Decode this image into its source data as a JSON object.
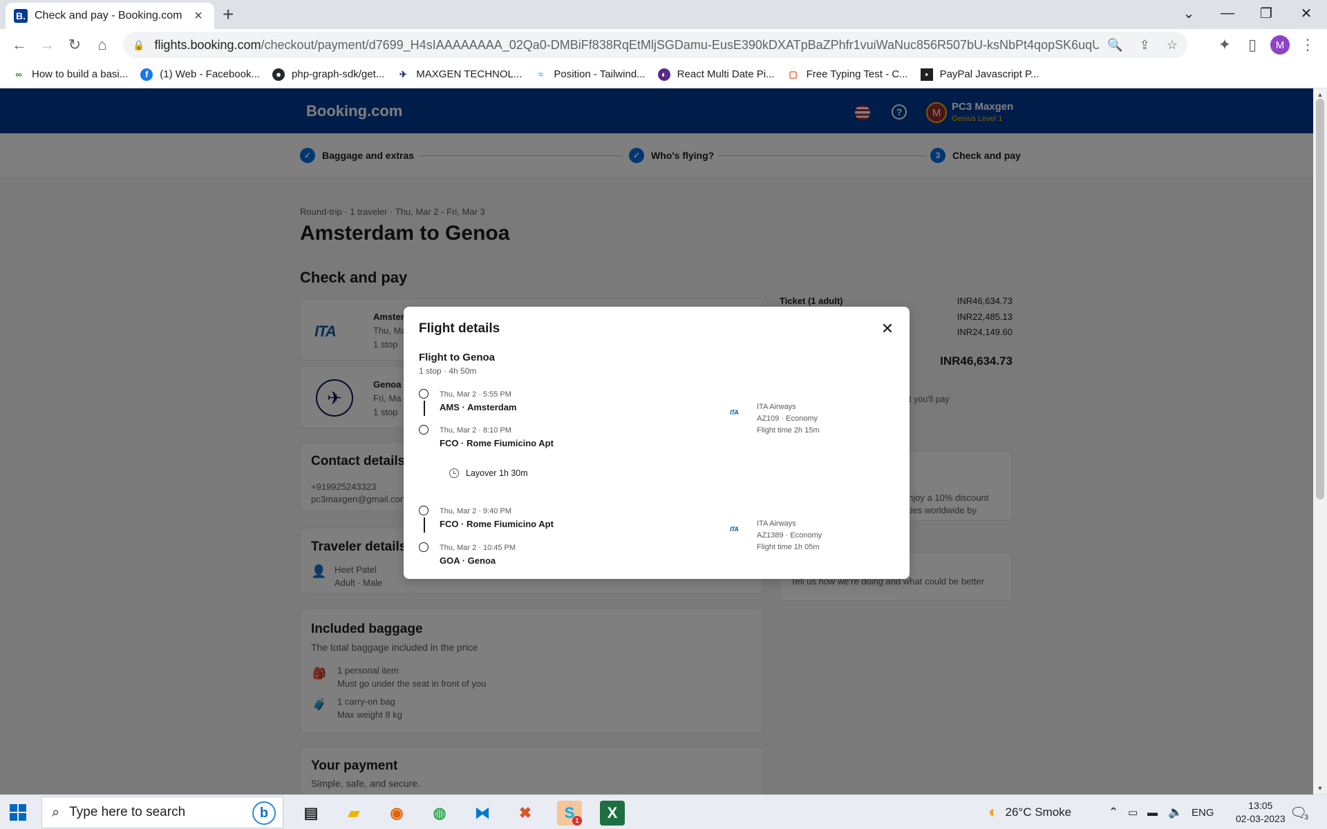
{
  "browser": {
    "tab_title": "Check and pay - Booking.com",
    "tab_favicon": "B.",
    "url_host": "flights.booking.com",
    "url_path": "/checkout/payment/d7699_H4sIAAAAAAAA_02Qa0-DMBiFf838RqEtMljSGDamu-EusE390kDXATpBaZPhfr1vuiWaNuc856R507bU-ksNbPt4qopSK6uqUdHopsi0RK...",
    "profile_initial": "M"
  },
  "bookmarks": [
    {
      "label": "How to build a basi...",
      "icon": "gg-icon"
    },
    {
      "label": "(1) Web - Facebook...",
      "icon": "facebook-icon"
    },
    {
      "label": "php-graph-sdk/get...",
      "icon": "github-icon"
    },
    {
      "label": "MAXGEN TECHNOL...",
      "icon": "maxgen-icon"
    },
    {
      "label": "Position - Tailwind...",
      "icon": "tailwind-icon"
    },
    {
      "label": "React Multi Date Pi...",
      "icon": "react-date-icon"
    },
    {
      "label": "Free Typing Test - C...",
      "icon": "typing-icon"
    },
    {
      "label": "PayPal Javascript P...",
      "icon": "paypal-icon"
    }
  ],
  "site": {
    "brand": "Booking.com",
    "user_initial": "M",
    "user_name": "PC3 Maxgen",
    "user_level": "Genius Level 1",
    "help": "?"
  },
  "steps": {
    "step1": "Baggage and extras",
    "step2": "Who's flying?",
    "step3_num": "3",
    "step3": "Check and pay"
  },
  "trip": {
    "crumb": "Round-trip  ·  1 traveler  ·  Thu, Mar 2 - Fri, Mar 3",
    "title": "Amsterdam to Genoa",
    "section": "Check and pay"
  },
  "flight_cards": [
    {
      "airline_logo": "ITA AIRWAYS",
      "title": "Amster",
      "date": "Thu, Ma",
      "stops": "1 stop"
    },
    {
      "airline_logo": "lufthansa-icon",
      "title": "Genoa",
      "date": "Fri, Ma",
      "stops": "1 stop"
    }
  ],
  "contact": {
    "title": "Contact details",
    "phone": "+919925243323",
    "email": "pc3maxgen@gmail.con"
  },
  "traveler": {
    "title": "Traveler details",
    "name": "Heet Patel",
    "meta": "Adult · Male"
  },
  "baggage": {
    "title": "Included baggage",
    "subtitle": "The total baggage included in the price",
    "items": [
      {
        "name": "1 personal item",
        "desc": "Must go under the seat in front of you"
      },
      {
        "name": "1 carry-on bag",
        "desc": "Max weight 8 kg"
      }
    ]
  },
  "payment": {
    "title": "Your payment",
    "subtitle": "Simple, safe, and secure."
  },
  "prices": {
    "ticket_label": "Ticket (1 adult)",
    "ticket": "INR46,634.73",
    "line2": "INR22,485.13",
    "line3": "INR24,149.60",
    "total": "INR46,634.73",
    "note": "t you'll pay",
    "promo_1": "njoy a 10% discount",
    "promo_2": "ties worldwide by",
    "feedback": "Tell us how we're doing and what could be better"
  },
  "modal": {
    "title": "Flight details",
    "subtitle": "Flight to Genoa",
    "summary": "1 stop · 4h 50m",
    "layover": "Layover 1h 30m",
    "segments": [
      {
        "dep_time": "Thu, Mar 2 · 5:55 PM",
        "dep_airport": "AMS · Amsterdam",
        "arr_time": "Thu, Mar 2 · 8:10 PM",
        "arr_airport": "FCO · Rome Fiumicino Apt",
        "airline": "ITA Airways",
        "flight": "AZ109 · Economy",
        "duration": "Flight time 2h 15m"
      },
      {
        "dep_time": "Thu, Mar 2 · 9:40 PM",
        "dep_airport": "FCO · Rome Fiumicino Apt",
        "arr_time": "Thu, Mar 2 · 10:45 PM",
        "arr_airport": "GOA · Genoa",
        "airline": "ITA Airways",
        "flight": "AZ1389 · Economy",
        "duration": "Flight time 1h 05m"
      }
    ]
  },
  "taskbar": {
    "search_placeholder": "Type here to search",
    "weather": "26°C  Smoke",
    "language": "ENG",
    "time": "13:05",
    "date": "02-03-2023",
    "notifications": "3",
    "skype_badge": "1"
  }
}
